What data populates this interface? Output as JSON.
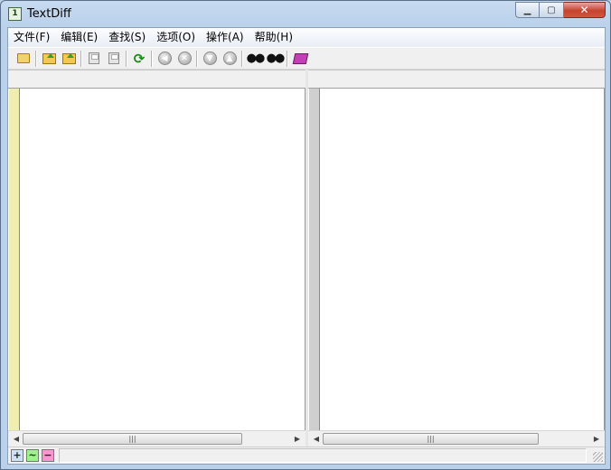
{
  "window": {
    "title": "TextDiff",
    "app_icon_text": "1"
  },
  "menu": [
    {
      "label": "文件(F)"
    },
    {
      "label": "编辑(E)"
    },
    {
      "label": "查找(S)"
    },
    {
      "label": "选项(O)"
    },
    {
      "label": "操作(A)"
    },
    {
      "label": "帮助(H)"
    }
  ],
  "toolbar": {
    "icons": [
      "new-folder-icon",
      "open-left-icon",
      "open-right-icon",
      "save-left-icon",
      "save-right-icon",
      "refresh-compare-icon",
      "prev-diff-icon",
      "next-diff-icon",
      "down-diff-icon",
      "up-diff-icon",
      "find-icon",
      "find-next-icon",
      "help-book-icon"
    ]
  },
  "panes": {
    "left_gutter_color": "#efeeb0",
    "right_gutter_color": "#cfcfcf",
    "scroll_thumb_label": "|||"
  },
  "statusbar": {
    "add_label": "+",
    "modify_label": "~",
    "delete_label": "−",
    "add_color": "#cfe1f7",
    "modify_color": "#9ef28c",
    "delete_color": "#f498cf"
  }
}
